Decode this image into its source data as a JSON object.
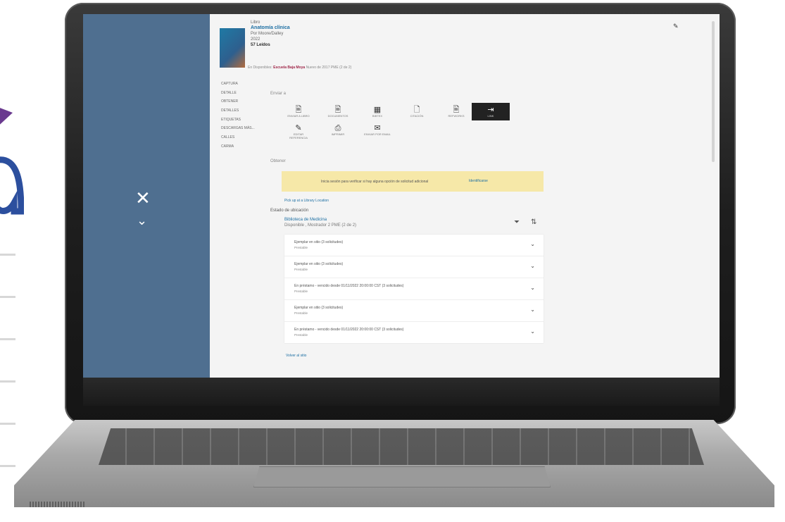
{
  "panel": {
    "close_icon": "✕",
    "chevron_icon": "⌄"
  },
  "record": {
    "label": "Libro",
    "title": "Anatomía clínica",
    "author": "Por Moore/Dalley",
    "year": "2022",
    "count": "57 Leídos",
    "holdings_prefix": "En Disponibles:",
    "holdings_location": "Escuela Baja Moya",
    "holdings_rest": "Nuevo de 2017 PME (2 de 2)"
  },
  "nav": [
    "CAPTURA",
    "DETALLE",
    "OBTENER",
    "DETALLES",
    "ETIQUETAS",
    "DESCARGAS MÁS...",
    "CALLES",
    "CARMA"
  ],
  "actions_section": "Enviar a",
  "actions": [
    {
      "label": "ENVIAR A LIBRO",
      "icon": "🖹"
    },
    {
      "label": "DOCUMENTOS",
      "icon": "🖹"
    },
    {
      "label": "BIBTEX",
      "icon": "▦"
    },
    {
      "label": "CITACIÓN",
      "icon": "🗋"
    },
    {
      "label": "REFWORKS",
      "icon": "🖹"
    },
    {
      "label": "LINK",
      "icon": "⇥"
    },
    {
      "label": "EDITAR REFERENCIA",
      "icon": "✎"
    },
    {
      "label": "IMPRIMIR",
      "icon": "⎙"
    },
    {
      "label": "ENVIAR POR EMAIL",
      "icon": "✉"
    }
  ],
  "obtain_section": "Obtener",
  "banner": {
    "message": "Inicia sesión para verificar si hay alguna opción de solicitud adicional",
    "sign_in": "Identificarse"
  },
  "pickup_link": "Pick up at a Library Location",
  "location_heading": "Estado de ubicación",
  "group": {
    "title": "Biblioteca de Medicina",
    "subtitle": "Disponible , Mostrador 2 PME (2 de 2)"
  },
  "items": [
    {
      "title": "Ejemplar en sitio (3 solicitudes)",
      "status": "Prestable",
      "icon": "⌄"
    },
    {
      "title": "Ejemplar en sitio (3 solicitudes)",
      "status": "Prestable",
      "icon": "⌄"
    },
    {
      "title": "En préstamo - vencido desde 01/11/2022 20:00:00 CST (3 solicitudes)",
      "status": "Prestable",
      "icon": "⌄"
    },
    {
      "title": "Ejemplar en sitio (3 solicitudes)",
      "status": "Prestable",
      "icon": "⌄"
    },
    {
      "title": "En préstamo - vencido desde 01/11/2022 20:00:00 CST (3 solicitudes)",
      "status": "Prestable",
      "icon": "⌄"
    }
  ],
  "back_link": "Volver al sitio",
  "colors": {
    "panel": "#4f6f90",
    "banner": "#f6e8a8",
    "link": "#1d6fa3",
    "holding_location": "#a0284a"
  }
}
